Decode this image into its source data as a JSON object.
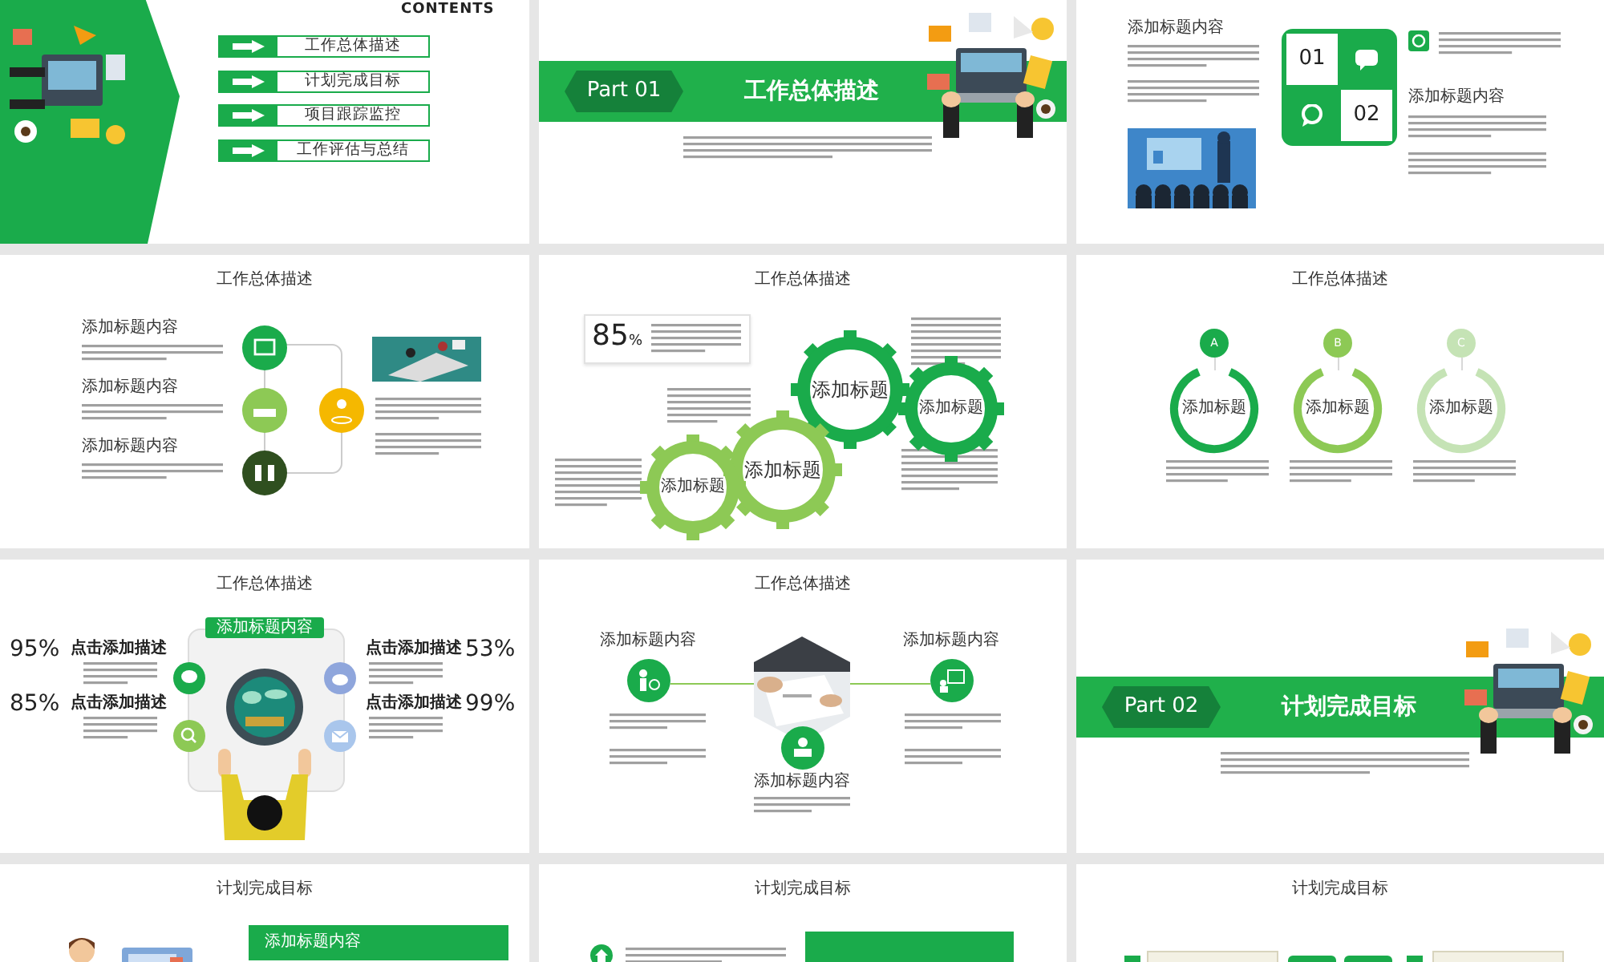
{
  "slides": [
    {
      "kind": "contents",
      "heading": "CONTENTS",
      "items": [
        "工作总体描述",
        "计划完成目标",
        "项目跟踪监控",
        "工作评估与总结"
      ]
    },
    {
      "kind": "section",
      "part": "Part 01",
      "title": "工作总体描述"
    },
    {
      "kind": "intro",
      "headings": [
        "添加标题内容",
        "添加标题内容"
      ],
      "numbers": [
        "01",
        "02"
      ]
    },
    {
      "kind": "timeline",
      "title": "工作总体描述",
      "headings": [
        "添加标题内容",
        "添加标题内容",
        "添加标题内容"
      ]
    },
    {
      "kind": "gears",
      "title": "工作总体描述",
      "stat_value": "85",
      "stat_unit": "%",
      "gears": [
        "添加标题",
        "添加标题",
        "添加标题",
        "添加标题"
      ]
    },
    {
      "kind": "rings",
      "title": "工作总体描述",
      "rings": [
        {
          "letter": "A",
          "label": "添加标题",
          "color": "#1aab4b"
        },
        {
          "letter": "B",
          "label": "添加标题",
          "color": "#8dc955"
        },
        {
          "letter": "C",
          "label": "添加标题",
          "color": "#c5e3b5"
        }
      ]
    },
    {
      "kind": "dashboard",
      "title": "工作总体描述",
      "banner": "添加标题内容",
      "stats": [
        {
          "value": "95%",
          "label": "点击添加描述"
        },
        {
          "value": "85%",
          "label": "点击添加描述"
        },
        {
          "value": "53%",
          "label": "点击添加描述"
        },
        {
          "value": "99%",
          "label": "点击添加描述"
        }
      ]
    },
    {
      "kind": "hexagon",
      "title": "工作总体描述",
      "headings": [
        "添加标题内容",
        "添加标题内容",
        "添加标题内容"
      ]
    },
    {
      "kind": "section",
      "part": "Part 02",
      "title": "计划完成目标"
    },
    {
      "kind": "plan_a",
      "title": "计划完成目标",
      "banner": "添加标题内容"
    },
    {
      "kind": "plan_b",
      "title": "计划完成目标"
    },
    {
      "kind": "plan_c",
      "title": "计划完成目标"
    }
  ]
}
